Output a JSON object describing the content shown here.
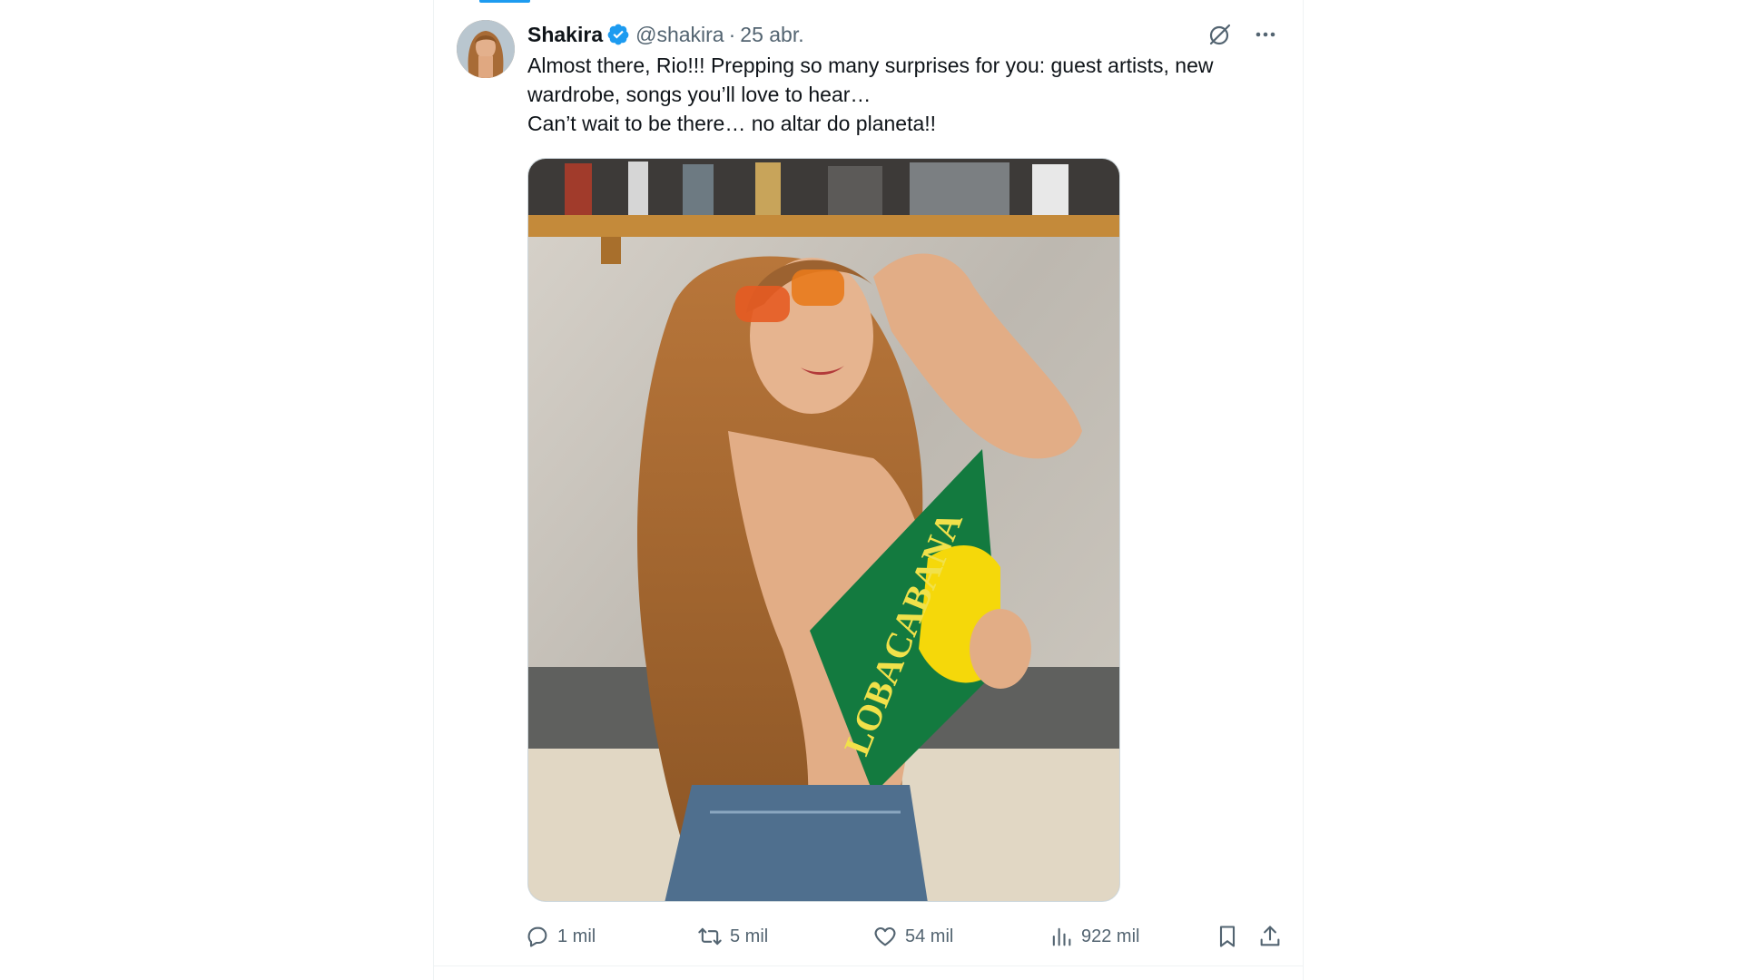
{
  "tweet": {
    "author": {
      "name": "Shakira",
      "handle": "@shakira",
      "verified": true,
      "avatar_icon": "profile-photo"
    },
    "separator": "·",
    "time": "25 abr.",
    "text_lines": [
      "Almost there, Rio!!! Prepping so many surprises for you: guest artists, new wardrobe, songs you’ll love to hear…",
      "Can’t wait to be there… no altar do planeta!!"
    ],
    "media": {
      "fan_text": "LOBACABANA"
    },
    "actions": {
      "reply_count": "1 mil",
      "repost_count": "5 mil",
      "like_count": "54 mil",
      "views_count": "922 mil"
    }
  },
  "colors": {
    "accent": "#1d9bf0",
    "text_primary": "#0f1419",
    "text_secondary": "#536471",
    "border": "#eff3f4"
  }
}
